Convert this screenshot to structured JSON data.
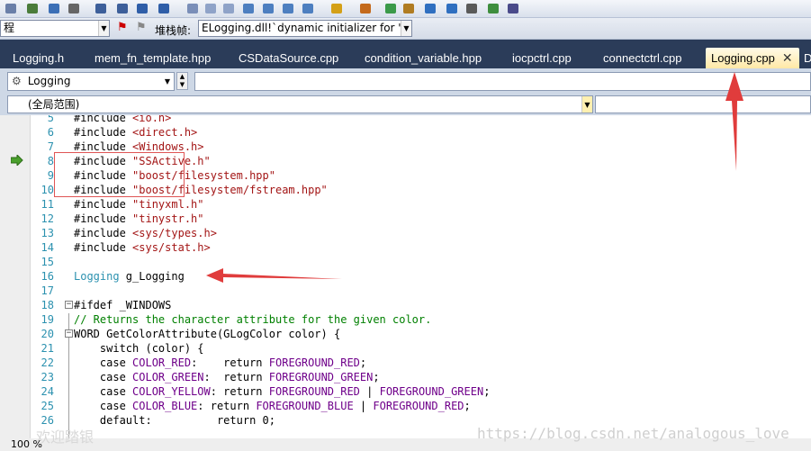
{
  "toolbar": {
    "icons": [
      "indent-icon",
      "format-icon",
      "bold-icon",
      "list-icon",
      "outdent-icon",
      "indent-more-icon",
      "align-icon",
      "sort-icon",
      "box-icon",
      "comment-icon",
      "uncomment-icon",
      "bookmark-icon",
      "bookmark-prev-icon",
      "bookmark-next-icon",
      "bookmark-clear-icon",
      "find-icon",
      "tools-icon",
      "palette-icon",
      "search-icon",
      "move-icon",
      "move-next-icon",
      "step-icon",
      "check-icon",
      "layout-icon"
    ]
  },
  "row2": {
    "left_combo": "程",
    "stack_label": "堆栈帧:",
    "stack_frame": "ELogging.dll!`dynamic initializer for 'g_"
  },
  "tabs": [
    {
      "label": "Logging.h"
    },
    {
      "label": "mem_fn_template.hpp"
    },
    {
      "label": "CSDataSource.cpp"
    },
    {
      "label": "condition_variable.hpp"
    },
    {
      "label": "iocpctrl.cpp"
    },
    {
      "label": "connectctrl.cpp"
    },
    {
      "label": "Logging.cpp",
      "active": true,
      "close": "✕"
    },
    {
      "label": "D"
    }
  ],
  "nav": {
    "class_combo": "Logging",
    "scope_combo": "(全局范围)"
  },
  "code_lines": [
    {
      "n": "5",
      "segments": [
        [
          "pp",
          "#include "
        ],
        [
          "str",
          "<io.h>"
        ]
      ]
    },
    {
      "n": "6",
      "segments": [
        [
          "pp",
          "#include "
        ],
        [
          "str",
          "<direct.h>"
        ]
      ]
    },
    {
      "n": "7",
      "segments": [
        [
          "pp",
          "#include "
        ],
        [
          "str",
          "<Windows.h>"
        ]
      ]
    },
    {
      "n": "8",
      "segments": [
        [
          "pp",
          "#include "
        ],
        [
          "str",
          "\"SSActive.h\""
        ]
      ]
    },
    {
      "n": "9",
      "segments": [
        [
          "pp",
          "#include "
        ],
        [
          "str",
          "\"boost/filesystem.hpp\""
        ]
      ]
    },
    {
      "n": "10",
      "segments": [
        [
          "pp",
          "#include "
        ],
        [
          "str",
          "\"boost/filesystem/fstream.hpp\""
        ]
      ]
    },
    {
      "n": "11",
      "segments": [
        [
          "pp",
          "#include "
        ],
        [
          "str",
          "\"tinyxml.h\""
        ]
      ]
    },
    {
      "n": "12",
      "segments": [
        [
          "pp",
          "#include "
        ],
        [
          "str",
          "\"tinystr.h\""
        ]
      ]
    },
    {
      "n": "13",
      "segments": [
        [
          "pp",
          "#include "
        ],
        [
          "str",
          "<sys/types.h>"
        ]
      ]
    },
    {
      "n": "14",
      "segments": [
        [
          "pp",
          "#include "
        ],
        [
          "str",
          "<sys/stat.h>"
        ]
      ]
    },
    {
      "n": "15",
      "segments": []
    },
    {
      "n": "16",
      "segments": [
        [
          "ty",
          "Logging"
        ],
        [
          "pp",
          " g_Logging"
        ]
      ]
    },
    {
      "n": "17",
      "segments": []
    },
    {
      "n": "18",
      "fold": "−",
      "segments": [
        [
          "pp",
          "#ifdef _WINDOWS"
        ]
      ]
    },
    {
      "n": "19",
      "segments": [
        [
          "cm",
          "// Returns the character attribute for the given color."
        ]
      ]
    },
    {
      "n": "20",
      "fold": "−",
      "segments": [
        [
          "pp",
          "WORD GetColorAttribute(GLogColor color) {"
        ]
      ]
    },
    {
      "n": "21",
      "segments": [
        [
          "pp",
          "    switch (color) {"
        ]
      ]
    },
    {
      "n": "22",
      "segments": [
        [
          "pp",
          "    case "
        ],
        [
          "mac",
          "COLOR_RED"
        ],
        [
          "pp",
          ":    return "
        ],
        [
          "mac",
          "FOREGROUND_RED"
        ],
        [
          "pp",
          ";"
        ]
      ]
    },
    {
      "n": "23",
      "segments": [
        [
          "pp",
          "    case "
        ],
        [
          "mac",
          "COLOR_GREEN"
        ],
        [
          "pp",
          ":  return "
        ],
        [
          "mac",
          "FOREGROUND_GREEN"
        ],
        [
          "pp",
          ";"
        ]
      ]
    },
    {
      "n": "24",
      "segments": [
        [
          "pp",
          "    case "
        ],
        [
          "mac",
          "COLOR_YELLOW"
        ],
        [
          "pp",
          ": return "
        ],
        [
          "mac",
          "FOREGROUND_RED"
        ],
        [
          "pp",
          " | "
        ],
        [
          "mac",
          "FOREGROUND_GREEN"
        ],
        [
          "pp",
          ";"
        ]
      ]
    },
    {
      "n": "25",
      "segments": [
        [
          "pp",
          "    case "
        ],
        [
          "mac",
          "COLOR_BLUE"
        ],
        [
          "pp",
          ": return "
        ],
        [
          "mac",
          "FOREGROUND_BLUE"
        ],
        [
          "pp",
          " | "
        ],
        [
          "mac",
          "FOREGROUND_RED"
        ],
        [
          "pp",
          ";"
        ]
      ]
    },
    {
      "n": "26",
      "segments": [
        [
          "pp",
          "    default:          return 0;"
        ]
      ]
    }
  ],
  "status": {
    "zoom": "100 %"
  },
  "watermark": {
    "url": "https://blog.csdn.net/analogous_love",
    "cn": "欢迎踏银"
  },
  "colors": {
    "tab_bar": "#2b3c59",
    "active_tab": "#ffe8a6",
    "annotation": "#e03c3c",
    "line_number": "#2b91af"
  }
}
